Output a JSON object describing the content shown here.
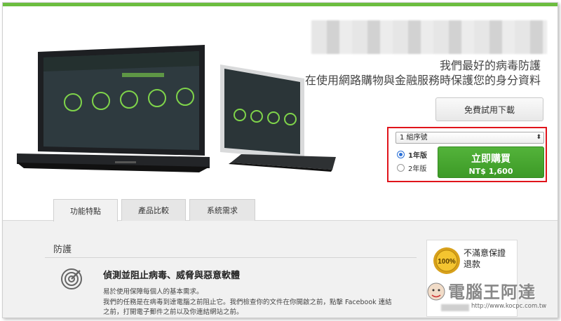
{
  "header": {
    "tagline_line1": "我們最好的病毒防護",
    "tagline_line2": "在使用網路購物與金融服務時保護您的身分資料"
  },
  "trial": {
    "label": "免費試用下載"
  },
  "purchase": {
    "license_selected": "1 組序號",
    "options": [
      {
        "label": "1年版",
        "selected": true
      },
      {
        "label": "2年版",
        "selected": false
      }
    ],
    "buy_label": "立即購買",
    "price": "NT$ 1,600"
  },
  "tabs": [
    {
      "label": "功能特點",
      "active": true
    },
    {
      "label": "產品比較",
      "active": false
    },
    {
      "label": "系統需求",
      "active": false
    }
  ],
  "section": {
    "heading": "防護",
    "feature_title": "偵測並阻止病毒、威脅與惡意軟體",
    "desc_line1": "易於使用保障每個人的基本需求。",
    "desc_line2": "我們的任務是在病毒到達電腦之前阻止它。我們檢查你的文件在你開啟之前，點擊 Facebook 連結",
    "desc_line3": "之前，打開電子郵件之前以及你連結網站之前。"
  },
  "guarantee": {
    "badge": "100%",
    "line1": "不滿意保證",
    "line2": "退款"
  },
  "watermark": {
    "title": "電腦王阿達",
    "url": "http://www.kocpc.com.tw"
  },
  "colors": {
    "brand_green": "#6cbd3f",
    "buy_green": "#4aa832",
    "highlight_red": "#e0141b"
  }
}
